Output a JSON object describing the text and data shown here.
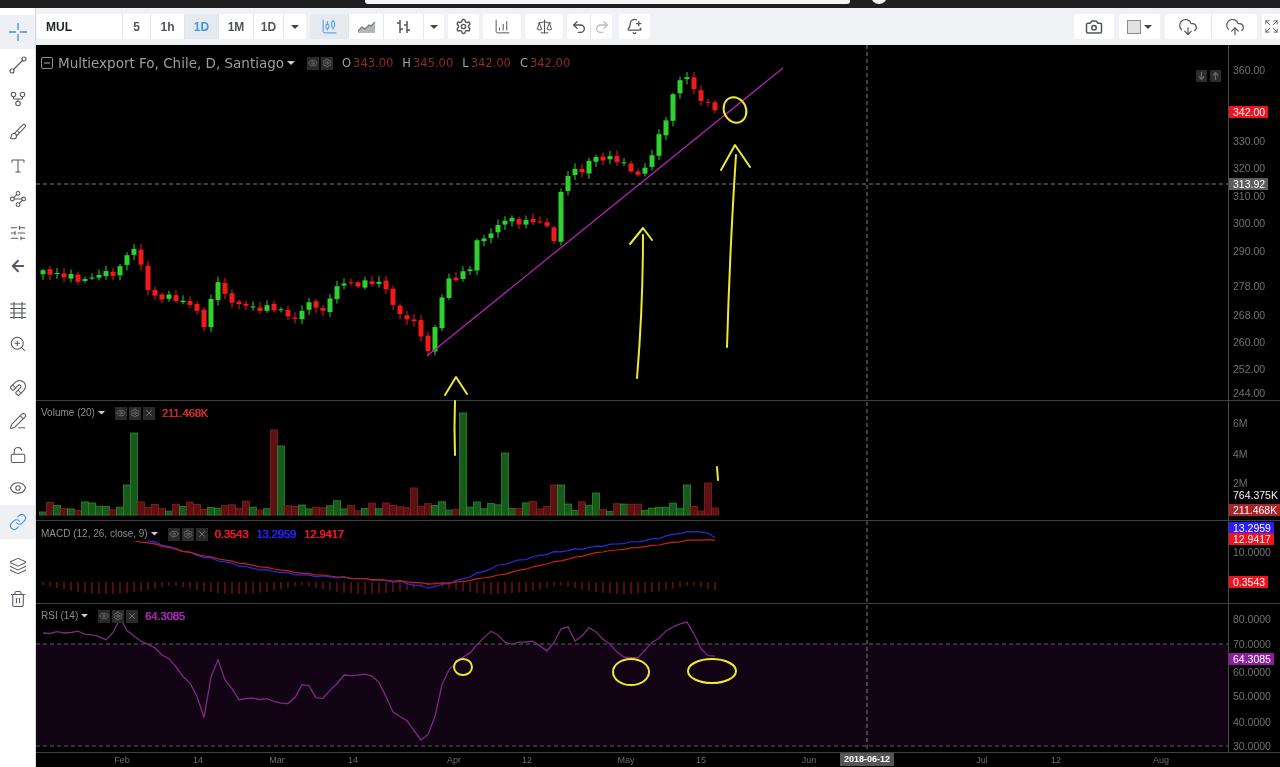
{
  "toolbar": {
    "symbol": "MUL",
    "intervals": [
      {
        "label": "5",
        "selected": false
      },
      {
        "label": "1h",
        "selected": false
      },
      {
        "label": "1D",
        "selected": true
      },
      {
        "label": "1M",
        "selected": false
      },
      {
        "label": "1D",
        "selected": false
      }
    ],
    "chart_styles": [
      {
        "kind": "candles",
        "selected": true
      },
      {
        "kind": "area",
        "selected": false
      },
      {
        "kind": "bars",
        "selected": false
      }
    ],
    "history": [
      {
        "kind": "undo",
        "disabled": false
      },
      {
        "kind": "redo",
        "disabled": true
      }
    ]
  },
  "left_toolbar": {
    "groups": [
      {
        "tools": [
          {
            "kind": "crosshair",
            "selected": true
          },
          {
            "kind": "trend-line",
            "selected": false
          },
          {
            "kind": "pitchfork",
            "selected": false
          },
          {
            "kind": "brush",
            "selected": false
          },
          {
            "kind": "text",
            "selected": false
          },
          {
            "kind": "pattern",
            "selected": false
          },
          {
            "kind": "measure",
            "selected": false
          },
          {
            "kind": "arrow",
            "selected": false
          }
        ]
      },
      {
        "tools": [
          {
            "kind": "grid",
            "selected": false
          },
          {
            "kind": "zoom",
            "selected": false
          }
        ]
      },
      {
        "tools": [
          {
            "kind": "magnet",
            "selected": false
          },
          {
            "kind": "drawing-lock",
            "selected": false
          },
          {
            "kind": "lock",
            "selected": false
          },
          {
            "kind": "visibility",
            "selected": false
          },
          {
            "kind": "link",
            "selected": true
          }
        ]
      },
      {
        "tools": [
          {
            "kind": "layers",
            "selected": false
          },
          {
            "kind": "remove",
            "selected": false
          }
        ]
      }
    ]
  },
  "panes": [
    {
      "kind": "price",
      "legend": {
        "title": "Multiexport Fo, Chile, D, Santiago",
        "values": [
          {
            "label": "O",
            "text": "343.00"
          },
          {
            "label": "H",
            "text": "345.00"
          },
          {
            "label": "L",
            "text": "342.00"
          },
          {
            "label": "C",
            "text": "342.00"
          }
        ]
      },
      "axis": [
        {
          "kind": "tick",
          "text": "360.00"
        },
        {
          "kind": "badge",
          "text": "342.00",
          "color": "#f0131e"
        },
        {
          "kind": "tick",
          "text": "330.00"
        },
        {
          "kind": "tick",
          "text": "320.00"
        },
        {
          "kind": "badge",
          "text": "313.92",
          "color": "#5d5d5d"
        },
        {
          "kind": "tick",
          "text": "310.00"
        },
        {
          "kind": "tick",
          "text": "300.00"
        },
        {
          "kind": "tick",
          "text": "290.00"
        },
        {
          "kind": "tick",
          "text": "278.00"
        },
        {
          "kind": "tick",
          "text": "268.00"
        },
        {
          "kind": "tick",
          "text": "260.00"
        },
        {
          "kind": "tick",
          "text": "252.00"
        },
        {
          "kind": "tick",
          "text": "244.00"
        }
      ]
    },
    {
      "kind": "volume",
      "legend": {
        "title": "Volume (20)",
        "values": [
          {
            "text": "211.468K",
            "color": "#c22b2b"
          }
        ]
      },
      "axis": [
        {
          "kind": "tick",
          "text": "6M"
        },
        {
          "kind": "tick",
          "text": "4M"
        },
        {
          "kind": "tick",
          "text": "2M"
        },
        {
          "kind": "value",
          "text": "764.375K"
        },
        {
          "kind": "badge",
          "text": "211.468K",
          "color": "#a8232a"
        }
      ]
    },
    {
      "kind": "macd",
      "legend": {
        "title": "MACD (12, 26, close, 9)",
        "values": [
          {
            "text": "0.3543",
            "color": "#f0131e"
          },
          {
            "text": "13.2959",
            "color": "#2b1bff"
          },
          {
            "text": "12.9417",
            "color": "#f0131e"
          }
        ]
      },
      "axis": [
        {
          "kind": "badge",
          "text": "13.2959",
          "color": "#2b1bff"
        },
        {
          "kind": "badge",
          "text": "12.9417",
          "color": "#f0131e"
        },
        {
          "kind": "tick",
          "text": "10.0000"
        },
        {
          "kind": "badge",
          "text": "0.3543",
          "color": "#f0131e"
        }
      ]
    },
    {
      "kind": "rsi",
      "legend": {
        "title": "RSI (14)",
        "values": [
          {
            "text": "64.3085",
            "color": "#a226ae"
          }
        ]
      },
      "axis": [
        {
          "kind": "tick",
          "text": "80.0000"
        },
        {
          "kind": "tick",
          "text": "70.0000"
        },
        {
          "kind": "badge",
          "text": "64.3085",
          "color": "#8e1d9e"
        },
        {
          "kind": "tick",
          "text": "60.0000"
        },
        {
          "kind": "tick",
          "text": "50.0000"
        },
        {
          "kind": "tick",
          "text": "40.0000"
        },
        {
          "kind": "tick",
          "text": "30.0000"
        }
      ]
    }
  ],
  "time_axis": {
    "labels": [
      "Feb",
      "14",
      "Mar",
      "14",
      "Apr",
      "12",
      "May",
      "15",
      "Jun",
      "Jul",
      "12",
      "Aug"
    ],
    "cursor": "2018-06-12"
  }
}
